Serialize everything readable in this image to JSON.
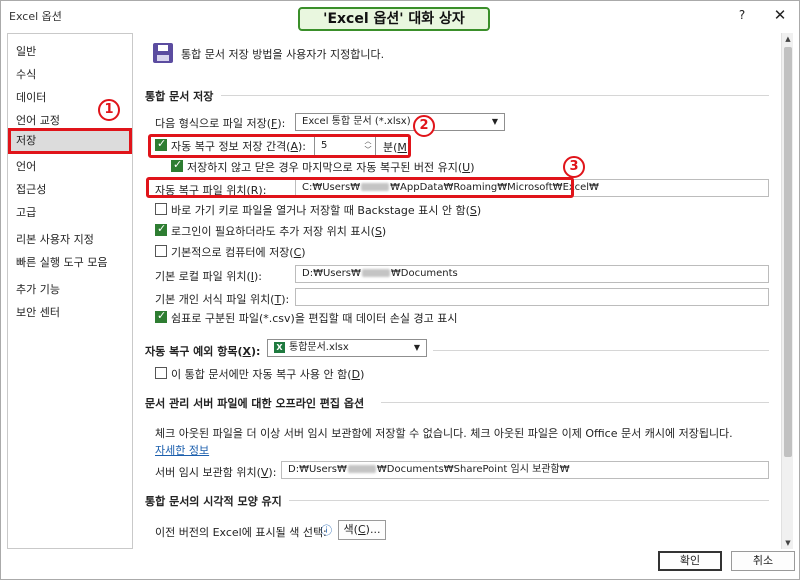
{
  "window": {
    "title": "Excel 옵션",
    "badge": "'Excel 옵션' 대화 상자",
    "help": "?",
    "close": "✕"
  },
  "sidebar": {
    "items": [
      {
        "label": "일반"
      },
      {
        "label": "수식"
      },
      {
        "label": "데이터"
      },
      {
        "label": "언어 교정"
      },
      {
        "label": "저장",
        "selected": true
      },
      {
        "label": "언어"
      },
      {
        "label": "접근성"
      },
      {
        "label": "고급"
      },
      {
        "label": "리본 사용자 지정"
      },
      {
        "label": "빠른 실행 도구 모음"
      },
      {
        "label": "추가 기능"
      },
      {
        "label": "보안 센터"
      }
    ]
  },
  "callouts": [
    "1",
    "2",
    "3"
  ],
  "header": {
    "description": "통합 문서 저장 방법을 사용자가 지정합니다."
  },
  "save_section": {
    "heading": "통합 문서 저장",
    "format_label": "다음 형식으로 파일 저장(",
    "format_key": "F",
    "format_label_end": "):",
    "format_value": "Excel 통합 문서 (*.xlsx)",
    "autorecover_label": "자동 복구 정보 저장 간격(",
    "autorecover_key": "A",
    "autorecover_label_end": "):",
    "autorecover_value": "5",
    "minutes_label": "분(",
    "minutes_key": "M",
    "minutes_label_end": ")",
    "keep_last_label": "저장하지 않고 닫은 경우 마지막으로 자동 복구된 버전 유지(",
    "keep_last_key": "U",
    "keep_last_end": ")",
    "ar_location_label": "자동 복구 파일 위치(",
    "ar_location_key": "R",
    "ar_location_end": "):",
    "ar_location_prefix": "C:₩Users₩",
    "ar_location_suffix": "₩AppData₩Roaming₩Microsoft₩Excel₩",
    "backstage_label": "바로 가기 키로 파일을 열거나 저장할 때 Backstage 표시 안 함(",
    "backstage_key": "S",
    "backstage_end": ")",
    "extra_locations_label": "로그인이 필요하더라도 추가 저장 위치 표시(",
    "extra_locations_key": "S",
    "extra_locations_end": ")",
    "save_to_computer_label": "기본적으로 컴퓨터에 저장(",
    "save_to_computer_key": "C",
    "save_to_computer_end": ")",
    "local_location_label": "기본 로컬 파일 위치(",
    "local_location_key": "I",
    "local_location_end": "):",
    "local_location_prefix": "D:₩Users₩",
    "local_location_suffix": "₩Documents",
    "template_location_label": "기본 개인 서식 파일 위치(",
    "template_location_key": "T",
    "template_location_end": "):",
    "template_location_value": "",
    "csv_warning_label": "쉼표로 구분된 파일(*.csv)을 편집할 때 데이터 손실 경고 표시"
  },
  "exceptions_section": {
    "heading": "자동 복구 예외 항목(",
    "heading_key": "X",
    "heading_end": "):",
    "workbook_value": "통합문서.xlsx",
    "disable_label": "이 통합 문서에만 자동 복구 사용 안 함(",
    "disable_key": "D",
    "disable_end": ")"
  },
  "offline_section": {
    "heading": "문서 관리 서버 파일에 대한 오프라인 편집 옵션",
    "description": "체크 아웃된 파일을 더 이상 서버 임시 보관함에 저장할 수 없습니다. 체크 아웃된 파일은 이제 Office 문서 캐시에 저장됩니다.",
    "more_info": "자세한 정보",
    "drafts_label": "서버 임시 보관함 위치(",
    "drafts_key": "V",
    "drafts_end": "):",
    "drafts_prefix": "D:₩Users₩",
    "drafts_suffix": "₩Documents₩SharePoint 임시 보관함₩"
  },
  "visual_section": {
    "heading": "통합 문서의 시각적 모양 유지",
    "colors_label": "이전 버전의 Excel에 표시될 색 선택:",
    "info_icon": "ⓘ",
    "colors_button": "색(",
    "colors_key": "C",
    "colors_end": ")..."
  },
  "footer": {
    "ok": "확인",
    "cancel": "취소"
  },
  "checkbox_states": {
    "autorecover": true,
    "keep_last": true,
    "backstage": false,
    "extra_locations": true,
    "save_to_computer": false,
    "csv_warning": true,
    "disable_autorecover": false
  },
  "colors": {
    "accent_green": "#2e7d32",
    "highlight_red": "#e0141a",
    "badge_border": "#3a8f2a",
    "link_blue": "#1c5fad"
  },
  "icons": {
    "save": "save-icon",
    "excel": "excel-file-icon",
    "info": "info-icon"
  }
}
